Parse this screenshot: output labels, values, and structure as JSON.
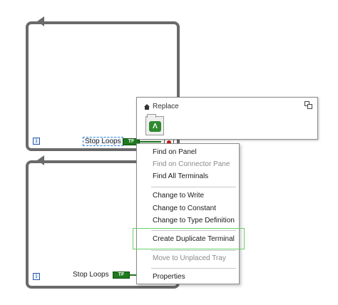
{
  "block_diagram": {
    "loops": [
      {
        "stop_label": "Stop Loops",
        "iteration_icon": "info-icon",
        "boolean_tag": "TF"
      },
      {
        "stop_label": "Stop Loops",
        "iteration_icon": "info-icon",
        "boolean_tag": "TF"
      }
    ],
    "iteration_glyph": "i"
  },
  "palette": {
    "header_label": "Replace",
    "icon": "home-icon",
    "restore_icon": "restore-window-icon",
    "item_icon": "boolean-constant-icon",
    "item_glyph": "Λ"
  },
  "context_menu": {
    "items": [
      {
        "label": "Find on Panel",
        "enabled": true
      },
      {
        "label": "Find on Connector Pane",
        "enabled": false
      },
      {
        "label": "Find All Terminals",
        "enabled": true
      },
      {
        "label": "Change to Write",
        "enabled": true
      },
      {
        "label": "Change to Constant",
        "enabled": true
      },
      {
        "label": "Change to Type Definition",
        "enabled": true
      },
      {
        "label": "Create Duplicate Terminal",
        "enabled": true,
        "highlighted": true
      },
      {
        "label": "Move to Unplaced Tray",
        "enabled": false
      },
      {
        "label": "Properties",
        "enabled": true
      }
    ]
  },
  "colors": {
    "loop_border": "#6a6a6a",
    "boolean_green": "#1f7a1f",
    "stop_red": "#c81818",
    "highlight_green": "#68d068",
    "disabled_text": "#8a8a8a"
  }
}
